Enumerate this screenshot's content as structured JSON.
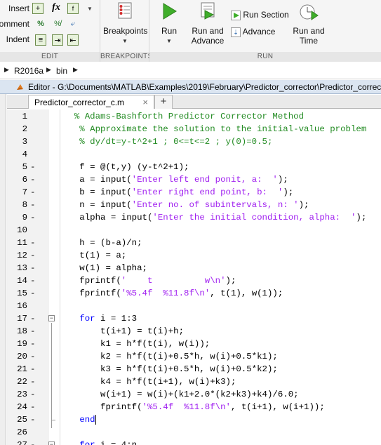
{
  "toolstrip": {
    "sections": {
      "edit": "EDIT",
      "breakpoints": "BREAKPOINTS",
      "run": "RUN"
    },
    "edit": {
      "insert": "Insert",
      "comment": "Comment",
      "indent": "Indent",
      "fx": "fx"
    },
    "breakpoints_button": "Breakpoints",
    "run_button": "Run",
    "run_and_advance": [
      "Run and",
      "Advance"
    ],
    "run_section": "Run Section",
    "advance": "Advance",
    "run_and_time": [
      "Run and",
      "Time"
    ]
  },
  "address": {
    "items": [
      "R2016a",
      "bin"
    ]
  },
  "editor": {
    "title": "Editor - G:\\Documents\\MATLAB\\Examples\\2019\\February\\Predictor_corrector\\Predictor_corrector.m",
    "tab_name": "Predictor_corrector_c.m",
    "close_glyph": "×",
    "new_tab_glyph": "+"
  },
  "colors": {
    "keyword": "#0000ff",
    "comment": "#228b22",
    "string": "#a020f0"
  },
  "code_lines": [
    {
      "n": "1",
      "dash": false,
      "segs": [
        {
          "t": "  % Adams-Bashforth Predictor Corrector Method",
          "c": "cm"
        }
      ]
    },
    {
      "n": "2",
      "dash": false,
      "segs": [
        {
          "t": "   % Approximate the solution to the initial-value problem",
          "c": "cm"
        }
      ]
    },
    {
      "n": "3",
      "dash": false,
      "segs": [
        {
          "t": "   % dy/dt=y-t^2+1 ; 0<=t<=2 ; y(0)=0.5;",
          "c": "cm"
        }
      ]
    },
    {
      "n": "4",
      "dash": false,
      "segs": []
    },
    {
      "n": "5",
      "dash": true,
      "segs": [
        {
          "t": "   f = @(t,y) (y-t^2+1);",
          "c": ""
        }
      ]
    },
    {
      "n": "6",
      "dash": true,
      "segs": [
        {
          "t": "   a = input(",
          "c": ""
        },
        {
          "t": "'Enter left end ponit, a:  '",
          "c": "st"
        },
        {
          "t": ");",
          "c": ""
        }
      ]
    },
    {
      "n": "7",
      "dash": true,
      "segs": [
        {
          "t": "   b = input(",
          "c": ""
        },
        {
          "t": "'Enter right end point, b:  '",
          "c": "st"
        },
        {
          "t": ");",
          "c": ""
        }
      ]
    },
    {
      "n": "8",
      "dash": true,
      "segs": [
        {
          "t": "   n = input(",
          "c": ""
        },
        {
          "t": "'Enter no. of subintervals, n: '",
          "c": "st"
        },
        {
          "t": ");",
          "c": ""
        }
      ]
    },
    {
      "n": "9",
      "dash": true,
      "segs": [
        {
          "t": "   alpha = input(",
          "c": ""
        },
        {
          "t": "'Enter the initial condition, alpha:  '",
          "c": "st"
        },
        {
          "t": ");",
          "c": ""
        }
      ]
    },
    {
      "n": "10",
      "dash": false,
      "segs": []
    },
    {
      "n": "11",
      "dash": true,
      "segs": [
        {
          "t": "   h = (b-a)/n;",
          "c": ""
        }
      ]
    },
    {
      "n": "12",
      "dash": true,
      "segs": [
        {
          "t": "   t(1) = a;",
          "c": ""
        }
      ]
    },
    {
      "n": "13",
      "dash": true,
      "segs": [
        {
          "t": "   w(1) = alpha;",
          "c": ""
        }
      ]
    },
    {
      "n": "14",
      "dash": true,
      "segs": [
        {
          "t": "   fprintf(",
          "c": ""
        },
        {
          "t": "'    t          w\\n'",
          "c": "st"
        },
        {
          "t": ");",
          "c": ""
        }
      ]
    },
    {
      "n": "15",
      "dash": true,
      "segs": [
        {
          "t": "   fprintf(",
          "c": ""
        },
        {
          "t": "'%5.4f  %11.8f\\n'",
          "c": "st"
        },
        {
          "t": ", t(1), w(1));",
          "c": ""
        }
      ]
    },
    {
      "n": "16",
      "dash": false,
      "segs": []
    },
    {
      "n": "17",
      "dash": true,
      "segs": [
        {
          "t": "   ",
          "c": ""
        },
        {
          "t": "for",
          "c": "kw"
        },
        {
          "t": " i = 1:3",
          "c": ""
        }
      ]
    },
    {
      "n": "18",
      "dash": true,
      "segs": [
        {
          "t": "       t(i+1) = t(i)+h;",
          "c": ""
        }
      ]
    },
    {
      "n": "19",
      "dash": true,
      "segs": [
        {
          "t": "       k1 = h*f(t(i), w(i));",
          "c": ""
        }
      ]
    },
    {
      "n": "20",
      "dash": true,
      "segs": [
        {
          "t": "       k2 = h*f(t(i)+0.5*h, w(i)+0.5*k1);",
          "c": ""
        }
      ]
    },
    {
      "n": "21",
      "dash": true,
      "segs": [
        {
          "t": "       k3 = h*f(t(i)+0.5*h, w(i)+0.5*k2);",
          "c": ""
        }
      ]
    },
    {
      "n": "22",
      "dash": true,
      "segs": [
        {
          "t": "       k4 = h*f(t(i+1), w(i)+k3);",
          "c": ""
        }
      ]
    },
    {
      "n": "23",
      "dash": true,
      "segs": [
        {
          "t": "       w(i+1) = w(i)+(k1+2.0*(k2+k3)+k4)/6.0;",
          "c": ""
        }
      ]
    },
    {
      "n": "24",
      "dash": true,
      "segs": [
        {
          "t": "       fprintf(",
          "c": ""
        },
        {
          "t": "'%5.4f  %11.8f\\n'",
          "c": "st"
        },
        {
          "t": ", t(i+1), w(i+1));",
          "c": ""
        }
      ]
    },
    {
      "n": "25",
      "dash": true,
      "segs": [
        {
          "t": "   ",
          "c": ""
        },
        {
          "t": "end",
          "c": "kw"
        }
      ]
    },
    {
      "n": "26",
      "dash": false,
      "segs": []
    },
    {
      "n": "27",
      "dash": true,
      "segs": [
        {
          "t": "   ",
          "c": ""
        },
        {
          "t": "for",
          "c": "kw"
        },
        {
          "t": " i = 4:n",
          "c": ""
        }
      ]
    }
  ]
}
